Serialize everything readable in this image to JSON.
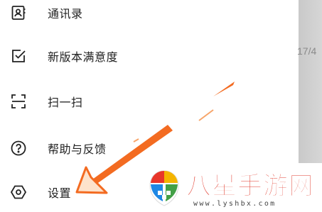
{
  "menu": {
    "items": [
      {
        "label": "通讯录",
        "icon": "contacts-icon"
      },
      {
        "label": "新版本满意度",
        "icon": "checkbox-icon"
      },
      {
        "label": "扫一扫",
        "icon": "scan-icon"
      },
      {
        "label": "帮助与反馈",
        "icon": "help-icon"
      },
      {
        "label": "设置",
        "icon": "settings-icon"
      }
    ]
  },
  "side_panel": {
    "time_text": "17/4"
  },
  "watermark": {
    "title": "八星手游网",
    "url": "www.lyshbx.com",
    "colors": {
      "title": "#e23a2c",
      "arrow": "#f36b21"
    }
  }
}
